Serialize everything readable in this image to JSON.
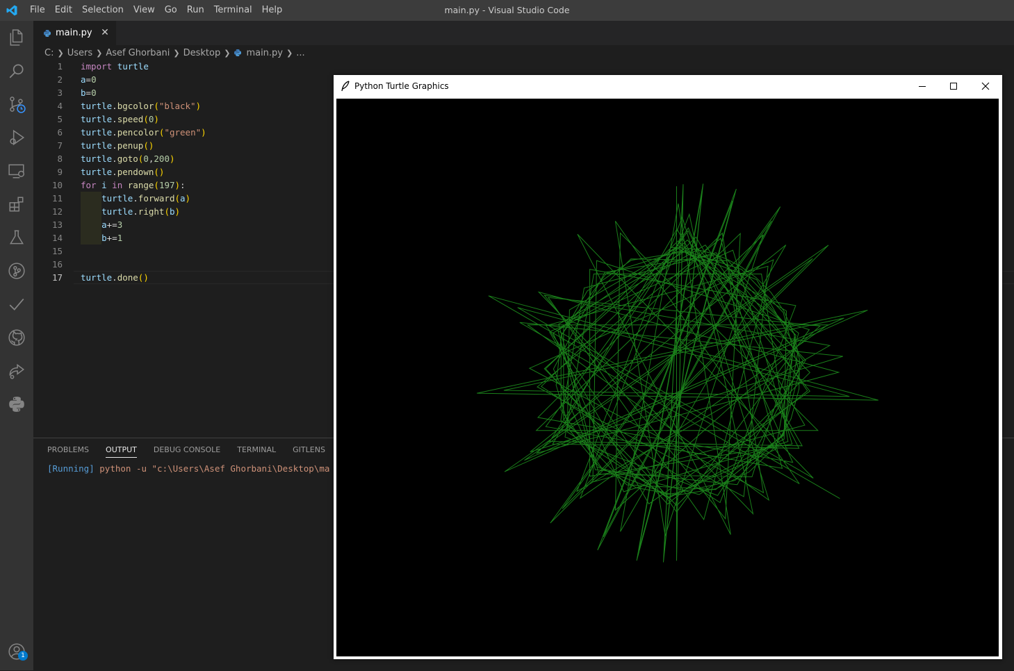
{
  "window": {
    "title": "main.py - Visual Studio Code"
  },
  "menu": [
    "File",
    "Edit",
    "Selection",
    "View",
    "Go",
    "Run",
    "Terminal",
    "Help"
  ],
  "activity_bar": {
    "items": [
      "explorer-icon",
      "search-icon",
      "source-control-icon",
      "run-debug-icon",
      "remote-explorer-icon",
      "extensions-icon",
      "testing-icon",
      "git-graph-icon",
      "checkmark-icon",
      "github-icon",
      "live-share-icon",
      "python-icon"
    ],
    "accounts_badge": "1"
  },
  "tabs": [
    {
      "label": "main.py",
      "close": "✕"
    }
  ],
  "breadcrumb": [
    "C:",
    "Users",
    "Asef Ghorbani",
    "Desktop",
    "main.py",
    "..."
  ],
  "editor": {
    "current_line": 17,
    "lines": [
      "import turtle",
      "a=0",
      "b=0",
      "turtle.bgcolor(\"black\")",
      "turtle.speed(0)",
      "turtle.pencolor(\"green\")",
      "turtle.penup()",
      "turtle.goto(0,200)",
      "turtle.pendown()",
      "for i in range(197):",
      "    turtle.forward(a)",
      "    turtle.right(b)",
      "    a+=3",
      "    b+=1",
      "",
      "",
      "turtle.done()"
    ]
  },
  "panel": {
    "tabs": [
      "PROBLEMS",
      "OUTPUT",
      "DEBUG CONSOLE",
      "TERMINAL",
      "GITLENS"
    ],
    "active_tab": "OUTPUT",
    "output": {
      "running": "[Running]",
      "command": "python -u \"c:\\Users\\Asef Ghorbani\\Desktop\\ma"
    }
  },
  "turtle_window": {
    "title": "Python Turtle Graphics",
    "bgcolor": "black",
    "pencolor": "green",
    "drawing": {
      "steps": 197,
      "step_increment": 3,
      "angle_increment": 1,
      "start": [
        0,
        200
      ]
    }
  },
  "colors": {
    "accent": "#007acc",
    "titlebar": "#3c3c3c",
    "activitybar": "#333333",
    "editor_bg": "#1e1e1e",
    "pen": "#1a7f1a"
  }
}
